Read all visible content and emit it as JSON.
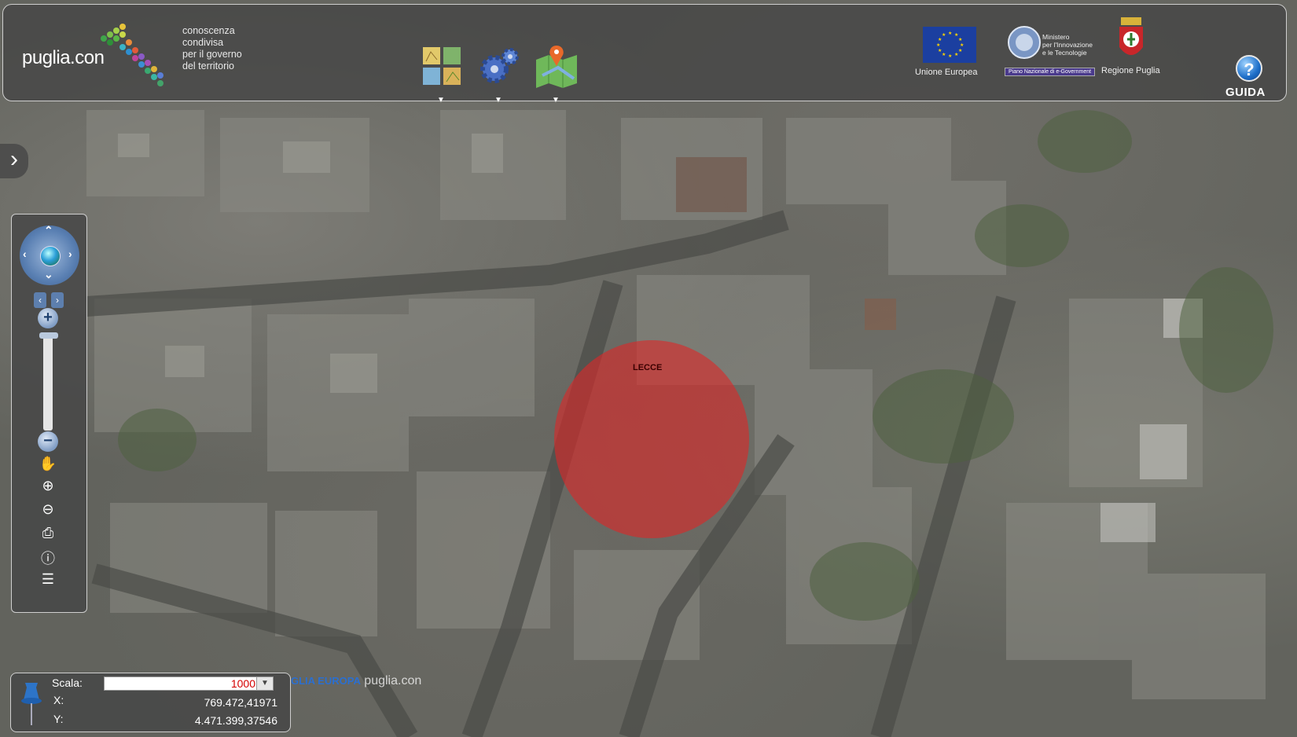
{
  "header": {
    "logo": {
      "name": "puglia.con",
      "tagline": [
        "conoscenza",
        "condivisa",
        "per il governo",
        "del territorio"
      ]
    },
    "tools": [
      {
        "icon": "layers-grid-icon"
      },
      {
        "icon": "gears-icon"
      },
      {
        "icon": "map-pin-icon"
      }
    ],
    "partners": {
      "eu_caption": "Unione Europea",
      "ministry_text": [
        "Ministero",
        "per l'Innovazione",
        "e le Tecnologie"
      ],
      "ministry_caption": "Piano Nazionale di e-Government",
      "region_caption": "Regione Puglia"
    },
    "guida_label": "GUIDA"
  },
  "map": {
    "marker_label": "LECCE",
    "marker_color": "#dc2828"
  },
  "coords": {
    "scale_label": "Scala:",
    "scale_value": "1000",
    "x_label": "X:",
    "x_value": "769.472,41971",
    "y_label": "Y:",
    "y_value": "4.471.399,37546"
  },
  "footer": {
    "logo_text": "GLIA EUROPA",
    "logo_sub": "puglia.con"
  }
}
